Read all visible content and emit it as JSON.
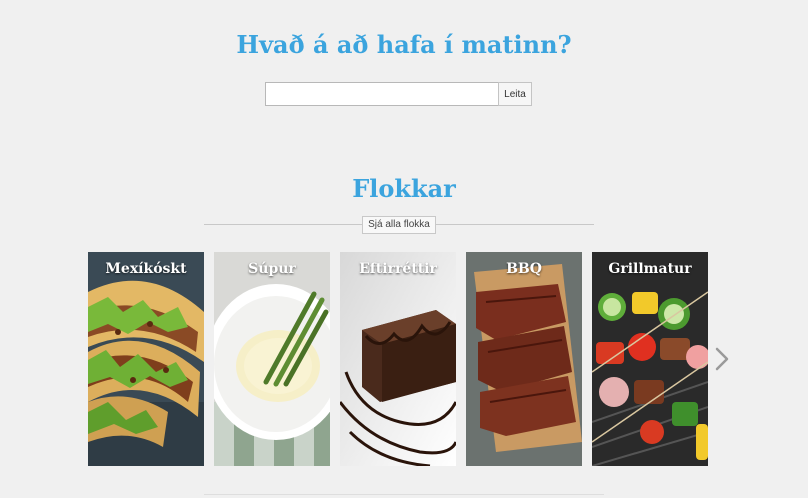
{
  "hero": {
    "title": "Hvað á að hafa í matinn?"
  },
  "search": {
    "value": "",
    "placeholder": "",
    "button_label": "Leita"
  },
  "categories": {
    "title": "Flokkar",
    "see_all_label": "Sjá alla flokka",
    "items": [
      {
        "label": "Mexíkóskt"
      },
      {
        "label": "Súpur"
      },
      {
        "label": "Eftirréttir"
      },
      {
        "label": "BBQ"
      },
      {
        "label": "Grillmatur"
      }
    ],
    "next_icon": "chevron-right-icon"
  },
  "colors": {
    "accent": "#3ba4de",
    "background": "#f0f0f0",
    "arrow": "#9a9a9a"
  }
}
